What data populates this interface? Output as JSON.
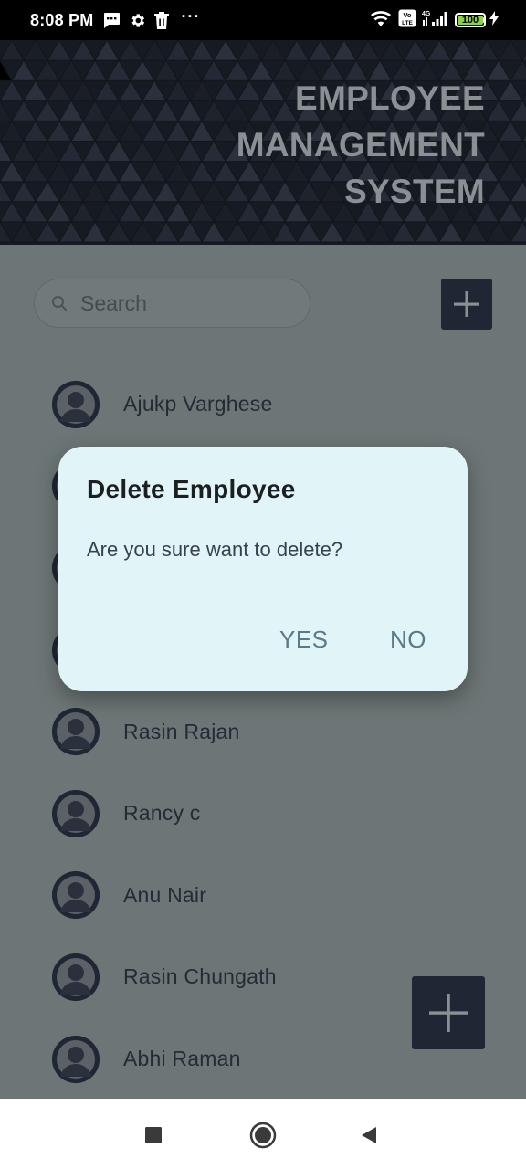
{
  "status_bar": {
    "time": "8:08 PM",
    "battery": "100",
    "battery_level": 1.0,
    "network": "4G",
    "volte": "Vo LTE",
    "more": "···",
    "left_icons": [
      "message-icon",
      "settings-icon",
      "trash-icon"
    ],
    "right_icons": [
      "wifi-icon",
      "volte-icon",
      "signal-icon",
      "battery-icon",
      "charging-icon"
    ]
  },
  "header": {
    "title_lines": [
      "EMPLOYEE",
      "MANAGEMENT",
      "SYSTEM"
    ],
    "background": "#161a22",
    "title_color": "#8a9093"
  },
  "search": {
    "placeholder": "Search",
    "value": ""
  },
  "employees": [
    {
      "name": "Ajukp Varghese"
    },
    {
      "name": ""
    },
    {
      "name": ""
    },
    {
      "name": ""
    },
    {
      "name": "Rasin Rajan"
    },
    {
      "name": "Rancy c"
    },
    {
      "name": "Anu Nair"
    },
    {
      "name": "Rasin Chungath"
    },
    {
      "name": "Abhi Raman"
    }
  ],
  "dialog": {
    "title": "Delete Employee",
    "message": "Are you sure want to delete?",
    "yes_label": "YES",
    "no_label": "NO",
    "background": "#e1f5f9",
    "button_color": "#5a7a88"
  },
  "colors": {
    "accent": "#1f2735",
    "scrim_content": "#6d7676"
  },
  "nav_bar": {
    "icons": [
      "recents-icon",
      "home-icon",
      "back-icon"
    ]
  }
}
